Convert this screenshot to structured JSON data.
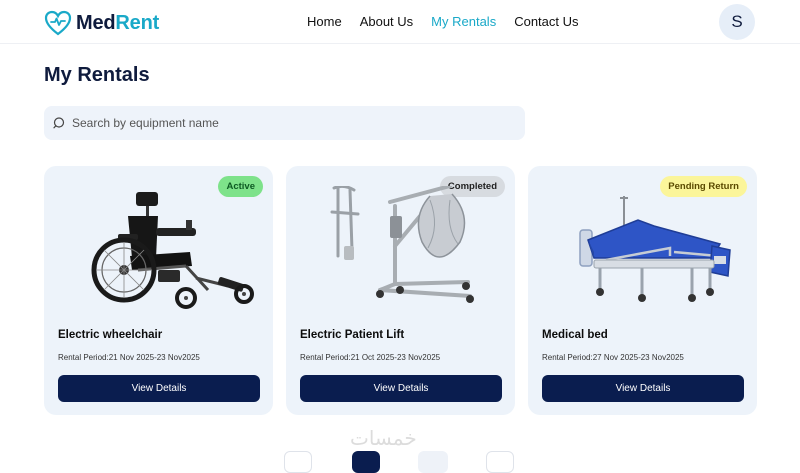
{
  "brand": {
    "name_part1": "Med",
    "name_part2": "Rent"
  },
  "nav": {
    "items": [
      {
        "label": "Home",
        "active": false
      },
      {
        "label": "About Us",
        "active": false
      },
      {
        "label": "My Rentals",
        "active": true
      },
      {
        "label": "Contact Us",
        "active": false
      }
    ]
  },
  "user": {
    "initial": "S"
  },
  "page": {
    "title": "My Rentals"
  },
  "search": {
    "placeholder": "Search by equipment name",
    "value": ""
  },
  "rentals": [
    {
      "name": "Electric wheelchair",
      "status": "Active",
      "period": "Rental Period:21 Nov 2025-23 Nov2025",
      "button": "View Details",
      "image_icon": "wheelchair-image"
    },
    {
      "name": "Electric Patient Lift",
      "status": "Completed",
      "period": "Rental Period:21 Oct 2025-23 Nov2025",
      "button": "View Details",
      "image_icon": "patient-lift-image"
    },
    {
      "name": "Medical bed",
      "status": "Pending Return",
      "period": "Rental Period:27 Nov 2025-23 Nov2025",
      "button": "View Details",
      "image_icon": "medical-bed-image"
    }
  ],
  "watermark": "خمسات",
  "colors": {
    "brand_teal": "#1aa9c8",
    "navy": "#0a1d4f",
    "card_bg": "#edf3fa",
    "active": "#7ee28a",
    "completed": "#d7dbe0",
    "pending": "#fbf59a"
  }
}
